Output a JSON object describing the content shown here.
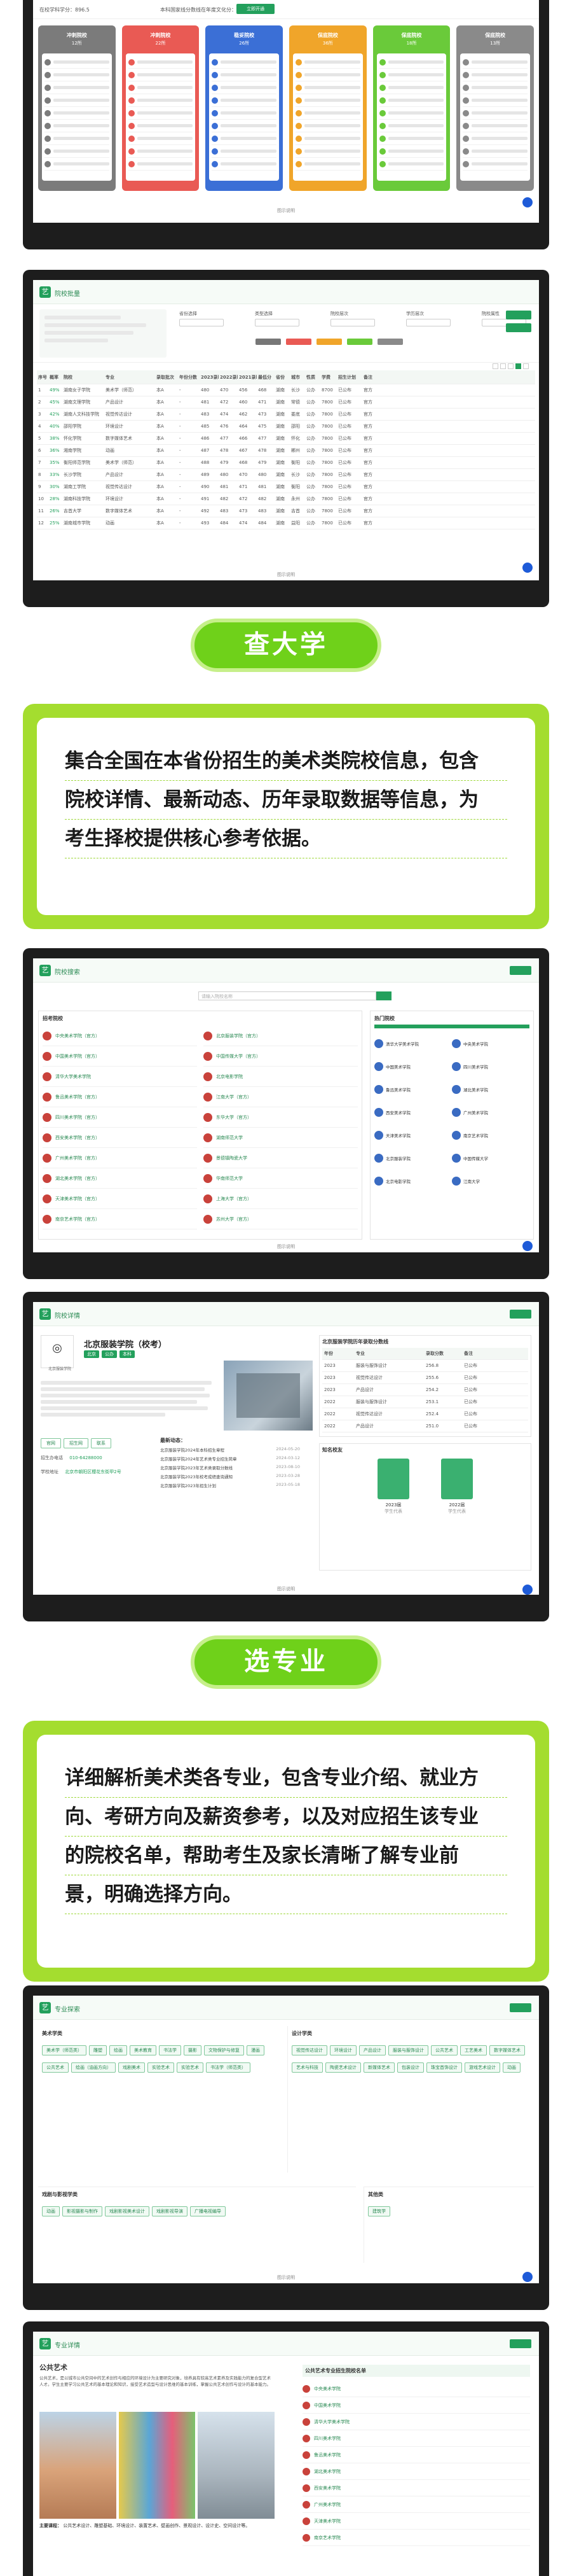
{
  "s1": {
    "top_left_text": "在校学科学分：896.5",
    "top_mid_text": "本科国家线分数线在年度文化分：7106",
    "top_btn": "立即开通",
    "cards": [
      {
        "title": "冲刺院校",
        "count": "12所",
        "color": "#7b7b7b"
      },
      {
        "title": "冲刺院校",
        "count": "22所",
        "color": "#e95a54"
      },
      {
        "title": "稳妥院校",
        "count": "26所",
        "color": "#3b6fd6"
      },
      {
        "title": "保底院校",
        "count": "36所",
        "color": "#f0a52a"
      },
      {
        "title": "保底院校",
        "count": "18所",
        "color": "#6aca3a"
      },
      {
        "title": "保底院校",
        "count": "13所",
        "color": "#8a8a8a"
      }
    ],
    "caption": "图示说明"
  },
  "s2": {
    "title": "院校批量",
    "filter_labels": [
      "省份选择",
      "类型选择",
      "院校层次",
      "学历层次",
      "院校属性"
    ],
    "table_head": [
      "序号",
      "概率",
      "院校",
      "专业",
      "录取批次",
      "年份分数",
      "2023录取",
      "2022录取",
      "2021录取",
      "最低分",
      "省份",
      "城市",
      "性质",
      "学费",
      "招生计划",
      "备注"
    ],
    "rows": [
      [
        "1",
        "49%",
        "湖南女子学院",
        "美术学（师范）",
        "本A",
        "-",
        "480",
        "470",
        "456",
        "468",
        "湖南",
        "长沙",
        "公办",
        "8700",
        "已公布",
        "官方"
      ],
      [
        "2",
        "45%",
        "湖南文理学院",
        "产品设计",
        "本A",
        "-",
        "481",
        "472",
        "460",
        "471",
        "湖南",
        "常德",
        "公办",
        "7800",
        "已公布",
        "官方"
      ],
      [
        "3",
        "42%",
        "湖南人文科技学院",
        "视觉传达设计",
        "本A",
        "-",
        "483",
        "474",
        "462",
        "473",
        "湖南",
        "娄底",
        "公办",
        "7800",
        "已公布",
        "官方"
      ],
      [
        "4",
        "40%",
        "邵阳学院",
        "环境设计",
        "本A",
        "-",
        "485",
        "476",
        "464",
        "475",
        "湖南",
        "邵阳",
        "公办",
        "7800",
        "已公布",
        "官方"
      ],
      [
        "5",
        "38%",
        "怀化学院",
        "数字媒体艺术",
        "本A",
        "-",
        "486",
        "477",
        "466",
        "477",
        "湖南",
        "怀化",
        "公办",
        "7800",
        "已公布",
        "官方"
      ],
      [
        "6",
        "36%",
        "湘南学院",
        "动画",
        "本A",
        "-",
        "487",
        "478",
        "467",
        "478",
        "湖南",
        "郴州",
        "公办",
        "7800",
        "已公布",
        "官方"
      ],
      [
        "7",
        "35%",
        "衡阳师范学院",
        "美术学（师范）",
        "本A",
        "-",
        "488",
        "479",
        "468",
        "479",
        "湖南",
        "衡阳",
        "公办",
        "7800",
        "已公布",
        "官方"
      ],
      [
        "8",
        "33%",
        "长沙学院",
        "产品设计",
        "本A",
        "-",
        "489",
        "480",
        "470",
        "480",
        "湖南",
        "长沙",
        "公办",
        "7800",
        "已公布",
        "官方"
      ],
      [
        "9",
        "30%",
        "湖南工学院",
        "视觉传达设计",
        "本A",
        "-",
        "490",
        "481",
        "471",
        "481",
        "湖南",
        "衡阳",
        "公办",
        "7800",
        "已公布",
        "官方"
      ],
      [
        "10",
        "28%",
        "湖南科技学院",
        "环境设计",
        "本A",
        "-",
        "491",
        "482",
        "472",
        "482",
        "湖南",
        "永州",
        "公办",
        "7800",
        "已公布",
        "官方"
      ],
      [
        "11",
        "26%",
        "吉首大学",
        "数字媒体艺术",
        "本A",
        "-",
        "492",
        "483",
        "473",
        "483",
        "湖南",
        "吉首",
        "公办",
        "7800",
        "已公布",
        "官方"
      ],
      [
        "12",
        "25%",
        "湖南城市学院",
        "动画",
        "本A",
        "-",
        "493",
        "484",
        "474",
        "484",
        "湖南",
        "益阳",
        "公办",
        "7800",
        "已公布",
        "官方"
      ]
    ],
    "caption": "图示说明"
  },
  "p1": {
    "label": "查大学"
  },
  "c1": {
    "lines": [
      "集合全国在本省份招生的美术类院校信息，包含",
      "院校详情、最新动态、历年录取数据等信息，为",
      "考生择校提供核心参考依据。"
    ]
  },
  "s3": {
    "title": "院校搜索",
    "search_placeholder": "请输入院校名称",
    "left_title": "招考院校",
    "right_title": "热门院校",
    "schools": [
      "中央美术学院（官方）",
      "中国美术学院（官方）",
      "清华大学美术学院",
      "鲁迅美术学院（官方）",
      "四川美术学院（官方）",
      "西安美术学院（官方）",
      "广州美术学院（官方）",
      "湖北美术学院（官方）",
      "天津美术学院（官方）",
      "南京艺术学院（官方）"
    ],
    "schools_b": [
      "北京服装学院（官方）",
      "中国传媒大学（官方）",
      "北京电影学院",
      "江南大学（官方）",
      "东华大学（官方）",
      "湖南师范大学",
      "景德镇陶瓷大学",
      "华南师范大学",
      "上海大学（官方）",
      "苏州大学（官方）"
    ],
    "hot": [
      "清华大学美术学院",
      "中央美术学院",
      "中国美术学院",
      "四川美术学院",
      "鲁迅美术学院",
      "湖北美术学院",
      "西安美术学院",
      "广州美术学院",
      "天津美术学院",
      "南京艺术学院",
      "北京服装学院",
      "中国传媒大学",
      "北京电影学院",
      "江南大学"
    ],
    "caption": "图示说明"
  },
  "s4": {
    "title": "院校详情",
    "school_name": "北京服装学院（校考）",
    "school_en": "北京服装学院",
    "tags": [
      "北京",
      "公办",
      "本科"
    ],
    "info_rows": [
      "学校类型：艺术类",
      "所在城市：北京",
      "学校层次：本科",
      "学校性质：公办"
    ],
    "news_title": "最新动态：",
    "news": [
      {
        "t": "北京服装学院2024年本科招生章程",
        "d": "2024-05-20"
      },
      {
        "t": "北京服装学院2024年艺术类专业招生简章",
        "d": "2024-03-12"
      },
      {
        "t": "北京服装学院2023年艺术类录取分数线",
        "d": "2023-08-10"
      },
      {
        "t": "北京服装学院2023年校考成绩查询通知",
        "d": "2023-03-28"
      },
      {
        "t": "北京服装学院2023年招生计划",
        "d": "2023-05-18"
      }
    ],
    "table_title": "北京服装学院历年录取分数线",
    "table_head": [
      "年份",
      "专业",
      "录取分数",
      "备注"
    ],
    "table_rows": [
      [
        "2023",
        "服装与服饰设计",
        "256.8",
        "已公布"
      ],
      [
        "2023",
        "视觉传达设计",
        "255.6",
        "已公布"
      ],
      [
        "2023",
        "产品设计",
        "254.2",
        "已公布"
      ],
      [
        "2022",
        "服装与服饰设计",
        "253.1",
        "已公布"
      ],
      [
        "2022",
        "视觉传达设计",
        "252.4",
        "已公布"
      ],
      [
        "2022",
        "产品设计",
        "251.0",
        "已公布"
      ]
    ],
    "people_title": "知名校友",
    "people": [
      {
        "name": "2023届",
        "sub": "学生代表"
      },
      {
        "name": "2022届",
        "sub": "学生代表"
      }
    ],
    "btns": [
      "官网",
      "招生网",
      "联系"
    ],
    "recruit_label": "招生办电话",
    "recruit_val": "010-64288000",
    "addr_label": "学校地址",
    "addr_val": "北京市朝阳区樱花东街甲2号",
    "caption": "图示说明"
  },
  "p2": {
    "label": "选专业"
  },
  "c2": {
    "lines": [
      "详细解析美术类各专业，包含专业介绍、就业方",
      "向、考研方向及薪资参考，以及对应招生该专业",
      "的院校名单，帮助考生及家长清晰了解专业前",
      "景，明确选择方向。"
    ]
  },
  "s5": {
    "title": "专业探索",
    "g1_title": "美术学类",
    "g1": [
      "美术学（师范类）",
      "雕塑",
      "绘画",
      "美术教育",
      "书法学",
      "摄影",
      "文物保护与修复",
      "漫画",
      "公共艺术",
      "绘画（油画方向）",
      "戏剧美术",
      "实验艺术",
      "实验艺术",
      "书法学（师范类）"
    ],
    "g2_title": "设计学类",
    "g2": [
      "视觉传达设计",
      "环境设计",
      "产品设计",
      "服装与服饰设计",
      "公共艺术",
      "工艺美术",
      "数字媒体艺术",
      "艺术与科技",
      "陶瓷艺术设计",
      "新媒体艺术",
      "包装设计",
      "珠宝首饰设计",
      "游戏艺术设计",
      "动画"
    ],
    "g3_title": "戏剧与影视学类",
    "g3": [
      "动画",
      "影视摄影与制作",
      "戏剧影视美术设计",
      "戏剧影视导演",
      "广播电视编导"
    ],
    "g4_title": "其他类",
    "g4": [
      "建筑学"
    ],
    "caption": "图示说明"
  },
  "s6": {
    "title": "专业详情",
    "major": "公共艺术",
    "intro": "公共艺术，是以城市公共空间中的艺术创作与相应的环境设计为主要研究对象，培养具有较高艺术素养及实践能力的复合型艺术人才。学生主要学习公共艺术的基本理论和知识，接受艺术造型与设计思维的基本训练，掌握公共艺术创作与设计的基本能力。",
    "caption1": "主要课程：",
    "courses": "公共艺术设计、雕塑基础、环境设计、装置艺术、壁画创作、景观设计、设计史、空间设计等。",
    "list_title": "公共艺术专业招生院校名单",
    "list": [
      "中央美术学院",
      "中国美术学院",
      "清华大学美术学院",
      "四川美术学院",
      "鲁迅美术学院",
      "湖北美术学院",
      "西安美术学院",
      "广州美术学院",
      "天津美术学院",
      "南京艺术学院"
    ]
  }
}
